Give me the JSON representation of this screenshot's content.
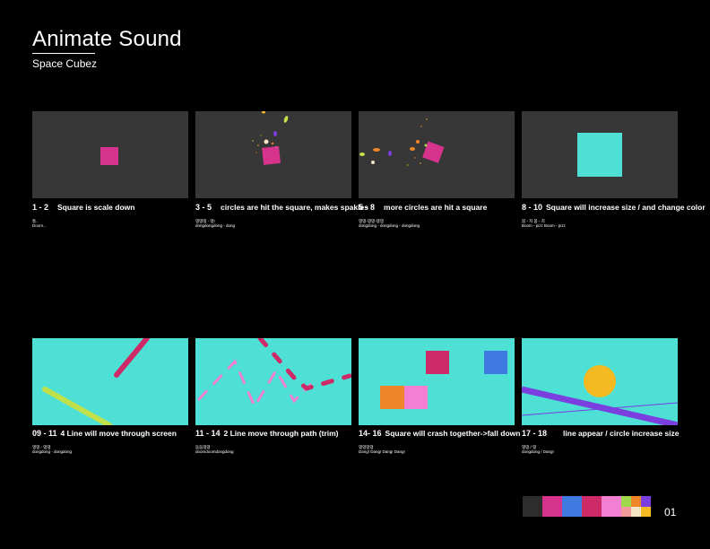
{
  "header": {
    "title": "Animate Sound",
    "subtitle": "Space Cubez"
  },
  "panels": [
    {
      "range": "1 - 2",
      "caption": "Square is scale down",
      "sfx_1": "퉁..",
      "sfx_2": "Doom..."
    },
    {
      "range": "3 - 5",
      "caption": "circles are hit the square, makes spakles",
      "sfx_1": "댕댕댕 - 댕!",
      "sfx_2": "dongdongdong - dong"
    },
    {
      "range": "5 - 8",
      "caption": "more circles are hit a square",
      "sfx_1": "댕댕-댕댕-댕댕",
      "sfx_2": "dongdong - dongdong - dongdong"
    },
    {
      "range": "8 - 10",
      "caption": "Square will increase size / and change color",
      "sfx_1": "붐 - 치 붐 - 치",
      "sfx_2": "Boom - pizz Boom - pizz"
    },
    {
      "range": "09 - 11",
      "caption": "4 Line will move through screen",
      "sfx_1": "댕댕 - 댕댕",
      "sfx_2": "dongdong - dongdong"
    },
    {
      "range": "11 - 14",
      "caption": "2 Line move through path (trim)",
      "sfx_1": "둠둠댕댕",
      "sfx_2": "doomdoomdongdong"
    },
    {
      "range": "14- 16",
      "caption": "Square will crash together->fall down",
      "sfx_1": "댕댕댕댕",
      "sfx_2": "Dang! Dang! Dang! Dang!"
    },
    {
      "range": "17 - 18",
      "caption": "line appear  / circle increase size",
      "sfx_1": "댕댕 / 댕",
      "sfx_2": "dongdong / Dang!"
    }
  ],
  "colors": {
    "dark_bg": "#373737",
    "teal_bg": "#4ee0d4",
    "magenta": "#d6338c",
    "crimson": "#cf2a68",
    "blue": "#3f7ae0",
    "pink": "#f27fd2",
    "orange": "#f0862a",
    "yellow": "#f5b922",
    "lime": "#c2e04a",
    "purple": "#7b3fe0"
  },
  "palette": [
    "#2d2d2d",
    "#d6338c",
    "#3f7ae0",
    "#cf2a68",
    "#f27fd2"
  ],
  "palette_grid": [
    "#9fd84a",
    "#f0862a",
    "#7b3fe0",
    "#f29a9a",
    "#f7e4c7",
    "#f5b922"
  ],
  "footer": {
    "page_number": "01"
  }
}
